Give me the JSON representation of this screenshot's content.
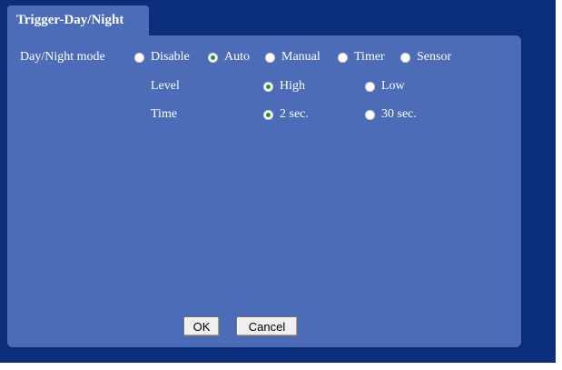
{
  "tab": {
    "title": "Trigger-Day/Night"
  },
  "day_night": {
    "label": "Day/Night mode",
    "options": [
      "Disable",
      "Auto",
      "Manual",
      "Timer",
      "Sensor"
    ],
    "selected": "Auto"
  },
  "level": {
    "label": "Level",
    "options": [
      "High",
      "Low"
    ],
    "selected": "High"
  },
  "time": {
    "label": "Time",
    "options": [
      "2 sec.",
      "30 sec."
    ],
    "selected": "2 sec."
  },
  "buttons": {
    "ok": "OK",
    "cancel": "Cancel"
  },
  "colors": {
    "background": "#0b2e7a",
    "panel": "#4d6cb7",
    "radio_selected": "#2f8a3a"
  }
}
